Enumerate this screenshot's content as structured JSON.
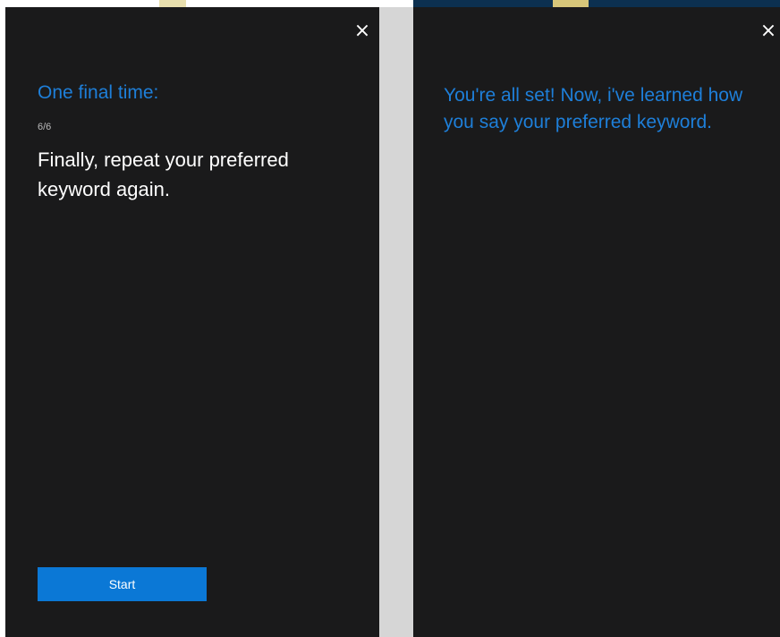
{
  "left_panel": {
    "close_icon": "×",
    "title": "One final time:",
    "step": "6/6",
    "instruction": "Finally, repeat your preferred keyword again.",
    "start_label": "Start"
  },
  "right_panel": {
    "close_icon": "×",
    "message": "You're all set! Now, i've learned how you say your preferred keyword."
  },
  "colors": {
    "panel_background": "#1a1a1b",
    "accent_blue": "#1e7fd9",
    "button_blue": "#0b78d6",
    "divider": "#d6d6d6"
  },
  "icons": {
    "close": "close-icon"
  }
}
